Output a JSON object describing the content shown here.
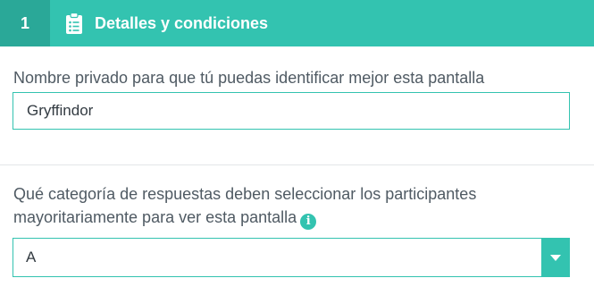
{
  "header": {
    "step_number": "1",
    "icon": "clipboard-list-icon",
    "title": "Detalles y condiciones"
  },
  "name_field": {
    "label": "Nombre privado para que tú puedas identificar mejor esta pantalla",
    "value": "Gryffindor"
  },
  "category_field": {
    "label": "Qué categoría de respuestas deben seleccionar los participantes mayoritariamente para ver esta pantalla",
    "info_icon": "info-icon",
    "selected_value": "A",
    "arrow_icon": "caret-down-icon"
  },
  "colors": {
    "accent": "#33c3b0",
    "accent_dark": "#2aa898",
    "label_text": "#4f5a63",
    "divider": "#e3e6e8"
  }
}
